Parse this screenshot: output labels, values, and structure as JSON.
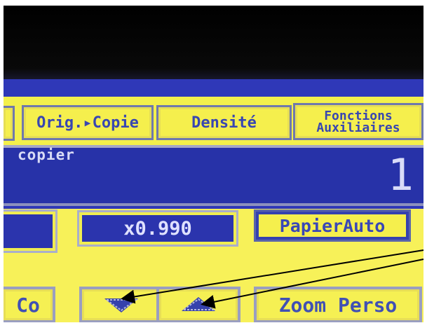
{
  "tabs": {
    "orig_copy": "Orig.▸Copie",
    "density": "Densité",
    "aux_line1": "Fonctions",
    "aux_line2": "Auxiliaires"
  },
  "display": {
    "mode_label": "copier",
    "copy_count": "1",
    "zoom_value": "x0.990",
    "paper_label": "PapierAuto"
  },
  "bottom_keys": {
    "left_partial": "Co",
    "down_icon": "triangle-down-icon",
    "up_icon": "triangle-up-icon",
    "zoom_custom": "Zoom Perso"
  },
  "colors": {
    "screen_blue": "#2b34ad",
    "panel_yellow": "#f5ef4d",
    "text_blue": "#3947b7"
  }
}
